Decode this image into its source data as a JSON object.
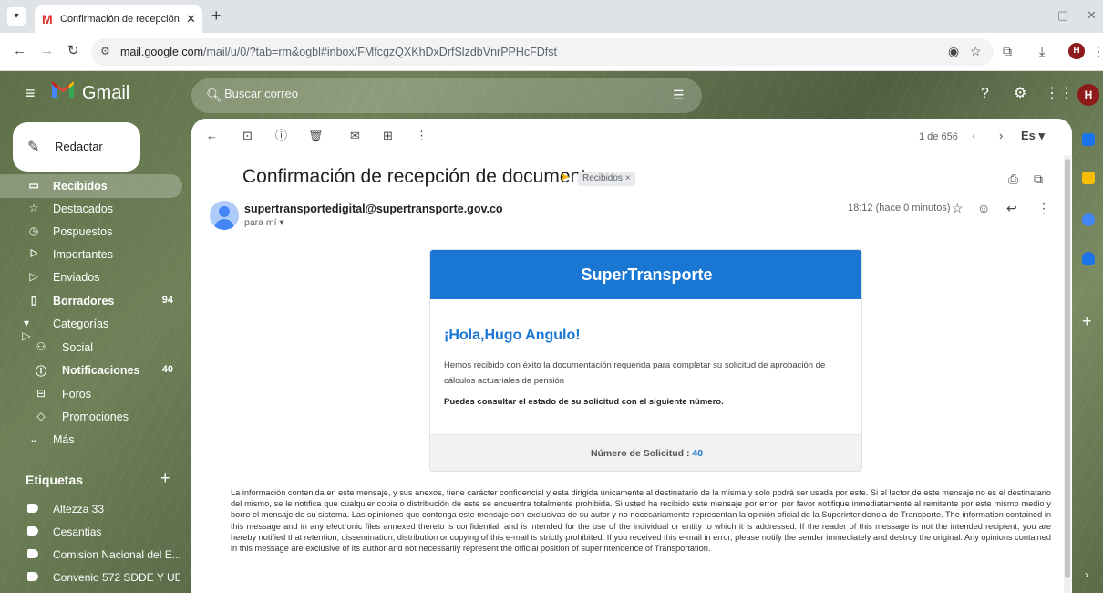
{
  "browser": {
    "tab_title": "Confirmación de recepción de",
    "tab_favicon": "M",
    "url_host": "mail.google.com",
    "url_path": "/mail/u/0/?tab=rm&ogbl#inbox/FMfcgzQXKhDxDrfSlzdbVnrPPHcFDfst",
    "profile_initial": "H"
  },
  "gmail": {
    "brand": "Gmail",
    "search_placeholder": "Buscar correo",
    "avatar_initial": "H",
    "compose_label": "Redactar",
    "nav": [
      {
        "label": "Recibidos",
        "icon": "inbox-icon",
        "count": ""
      },
      {
        "label": "Destacados",
        "icon": "star-icon",
        "count": ""
      },
      {
        "label": "Pospuestos",
        "icon": "clock-icon",
        "count": ""
      },
      {
        "label": "Importantes",
        "icon": "important-icon",
        "count": ""
      },
      {
        "label": "Enviados",
        "icon": "send-icon",
        "count": ""
      },
      {
        "label": "Borradores",
        "icon": "draft-icon",
        "count": "94"
      },
      {
        "label": "Categorías",
        "icon": "label-icon",
        "count": ""
      },
      {
        "label": "Social",
        "icon": "people-icon",
        "count": ""
      },
      {
        "label": "Notificaciones",
        "icon": "info-icon",
        "count": "40"
      },
      {
        "label": "Foros",
        "icon": "forum-icon",
        "count": ""
      },
      {
        "label": "Promociones",
        "icon": "tag-icon",
        "count": ""
      },
      {
        "label": "Más",
        "icon": "chevron-down-icon",
        "count": ""
      }
    ],
    "labels_heading": "Etiquetas",
    "labels": [
      "Altezza 33",
      "Cesantias",
      "Comision Nacional del E...",
      "Convenio 572 SDDE Y UD"
    ]
  },
  "message": {
    "pagination": "1 de 656",
    "language": "Es",
    "subject": "Confirmación de recepción de documentos",
    "inbox_chip": "Recibidos ×",
    "sender": "supertransportedigital@supertransporte.gov.co",
    "recipient": "para mí ▾",
    "time": "18:12 (hace 0 minutos)",
    "card": {
      "brand": "SuperTransporte",
      "greeting": "¡Hola,Hugo Angulo!",
      "body": "Hemos recibido con éxito la documentación requerida para completar su solicitud de aprobación de cálculos actuariales de pensión",
      "strong": "Puedes consultar el estado de su solicitud con el siguiente número.",
      "request_label": "Número de Solicitud :",
      "request_number": "40"
    },
    "disclaimer": "La información contenida en este mensaje, y sus anexos, tiene carácter confidencial y esta dirigida únicamente al destinatario de la misma y solo podrá ser usada por este. Si el lector de este mensaje no es el destinatario del mismo, se le notifica que cualquier copia o distribución de este se encuentra totalmente prohibida. Si usted ha recibido este mensaje por error, por favor notifique inmediatamente al remitente por este mismo medio y borre el mensaje de su sistema. Las opiniones que contenga este mensaje son exclusivas de su autor y no necesariamente representan la opinión oficial de la Superintendencia de Transporte. The information contained in this message and in any electronic files annexed thereto is confidential, and is intended for the use of the individual or entity to which it is addressed. If the reader of this message is not the intended recipient, you are hereby notified that retention, dissemination, distribution or copying of this e-mail is strictly prohibited. If you received this e-mail in error, please notify the sender immediately and destroy the original. Any opinions contained in this message are exclusive of its author and not necessarily represent the official position of superintendence of Transportation."
  },
  "colors": {
    "accent_blue": "#1976d2",
    "important_yellow": "#f6b400",
    "profile_red": "#8e1b1b"
  }
}
